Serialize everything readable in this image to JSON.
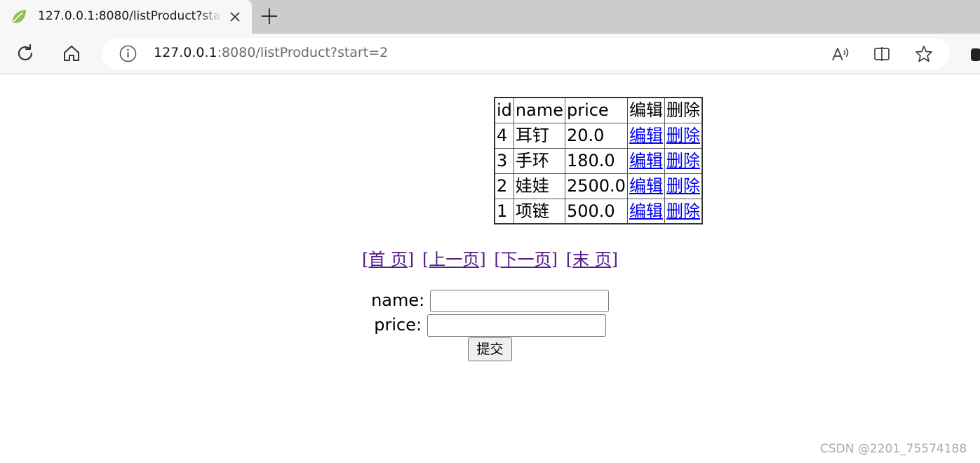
{
  "browser": {
    "tab": {
      "title": "127.0.0.1:8080/listProduct?start=2",
      "favicon": "spring-leaf-icon"
    },
    "address_bar": {
      "url_host": "127.0.0.1",
      "url_rest": ":8080/listProduct?start=2"
    }
  },
  "table": {
    "headers": [
      "id",
      "name",
      "price",
      "编辑",
      "删除"
    ],
    "rows": [
      {
        "id": "4",
        "name": "耳钉",
        "price": "20.0",
        "edit": "编辑",
        "delete": "删除"
      },
      {
        "id": "3",
        "name": "手环",
        "price": "180.0",
        "edit": "编辑",
        "delete": "删除"
      },
      {
        "id": "2",
        "name": "娃娃",
        "price": "2500.0",
        "edit": "编辑",
        "delete": "删除"
      },
      {
        "id": "1",
        "name": "项链",
        "price": "500.0",
        "edit": "编辑",
        "delete": "删除"
      }
    ]
  },
  "pager": {
    "first": "[首 页]",
    "prev": "[上一页]",
    "next": "[下一页]",
    "last": "[末 页]"
  },
  "form": {
    "name_label": "name:",
    "name_value": "",
    "price_label": "price:",
    "price_value": "",
    "submit_label": "提交"
  },
  "watermark": "CSDN @2201_75574188",
  "colors": {
    "link": "#0000ee",
    "visited_link": "#551a8b",
    "tabstrip": "#cccccc",
    "toolbar": "#f7f7f7"
  }
}
